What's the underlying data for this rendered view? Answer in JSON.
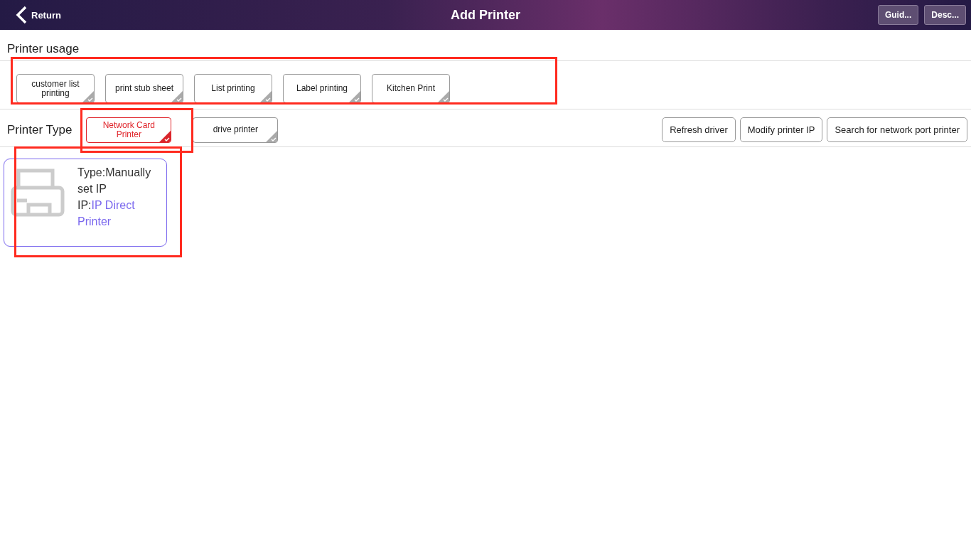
{
  "header": {
    "back_label": "Return",
    "title": "Add Printer",
    "buttons": [
      "Guid...",
      "Desc..."
    ]
  },
  "usage": {
    "label": "Printer usage",
    "options": [
      {
        "label": "customer list printing",
        "selected": false
      },
      {
        "label": "print stub sheet",
        "selected": false
      },
      {
        "label": "List printing",
        "selected": false
      },
      {
        "label": "Label printing",
        "selected": false
      },
      {
        "label": "Kitchen Print",
        "selected": false
      }
    ]
  },
  "printer_type": {
    "label": "Printer Type",
    "options": [
      {
        "label": "Network Card Printer",
        "selected": true
      },
      {
        "label": "drive printer",
        "selected": false
      }
    ],
    "actions": [
      "Refresh driver",
      "Modify printer IP",
      "Search for network port printer"
    ]
  },
  "printers": [
    {
      "type_label": "Type:",
      "type_value": "Manually set IP",
      "ip_label": "IP:",
      "ip_value": "IP Direct Printer"
    }
  ]
}
